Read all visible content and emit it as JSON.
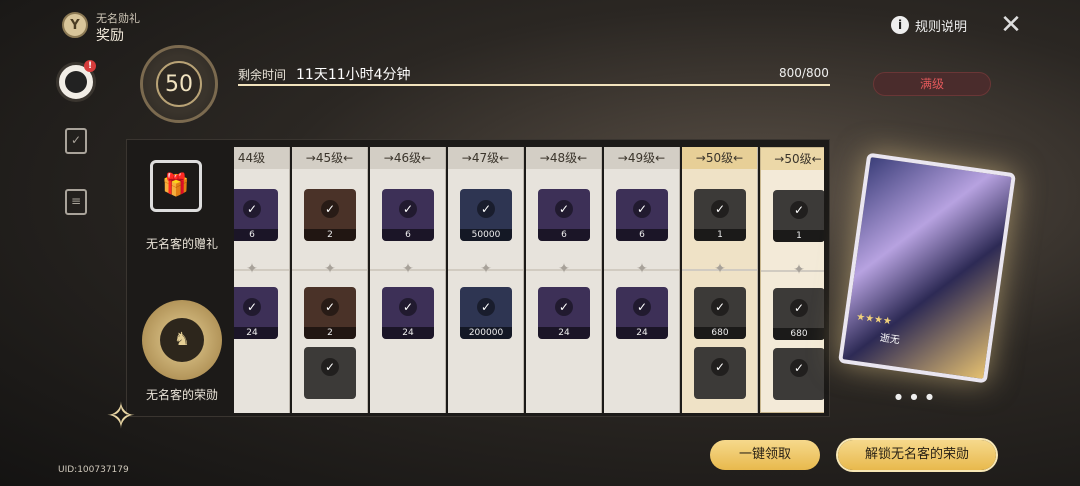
{
  "header": {
    "subtitle": "无名勋礼",
    "title": "奖励",
    "rules_label": "规则说明",
    "emblem_glyph": "Y"
  },
  "nav": {
    "badge": "!",
    "items": [
      {
        "name": "nav-battle-pass",
        "icon": "emblem-icon"
      },
      {
        "name": "nav-tasks",
        "icon": "clipboard-icon"
      },
      {
        "name": "nav-log",
        "icon": "document-icon"
      }
    ]
  },
  "level": {
    "current": "50",
    "time_label": "剩余时间",
    "time_value": "11天11小时4分钟",
    "exp": "800/800",
    "progress": 1.0,
    "max_label": "满级"
  },
  "rows": {
    "free_label": "无名客的赠礼",
    "honor_label": "无名客的荣勋"
  },
  "columns": [
    {
      "label": "44级",
      "style": "normal",
      "free": {
        "qty": "6",
        "color": "purple"
      },
      "honor": [
        {
          "qty": "24",
          "color": "purple"
        }
      ]
    },
    {
      "label": "→45级←",
      "style": "normal",
      "free": {
        "qty": "2",
        "color": "orange"
      },
      "honor": [
        {
          "qty": "2",
          "color": "orange"
        },
        {
          "qty": "",
          "color": "gray"
        }
      ]
    },
    {
      "label": "→46级←",
      "style": "normal",
      "free": {
        "qty": "6",
        "color": "purple"
      },
      "honor": [
        {
          "qty": "24",
          "color": "purple"
        }
      ]
    },
    {
      "label": "→47级←",
      "style": "normal",
      "free": {
        "qty": "50000",
        "color": "blue"
      },
      "honor": [
        {
          "qty": "200000",
          "color": "blue"
        }
      ]
    },
    {
      "label": "→48级←",
      "style": "normal",
      "free": {
        "qty": "6",
        "color": "purple"
      },
      "honor": [
        {
          "qty": "24",
          "color": "purple"
        }
      ]
    },
    {
      "label": "→49级←",
      "style": "normal",
      "free": {
        "qty": "6",
        "color": "purple"
      },
      "honor": [
        {
          "qty": "24",
          "color": "purple"
        }
      ]
    },
    {
      "label": "→50级←",
      "style": "gold",
      "free": {
        "qty": "1",
        "color": "gray"
      },
      "honor": [
        {
          "qty": "680",
          "color": "gray"
        },
        {
          "qty": "",
          "color": "gray"
        }
      ]
    },
    {
      "label": "→50级←",
      "style": "cur",
      "free": {
        "qty": "1",
        "color": "gray"
      },
      "honor": [
        {
          "qty": "680",
          "color": "gray"
        },
        {
          "qty": "",
          "color": "gray"
        }
      ]
    }
  ],
  "card": {
    "name": "逝无",
    "stars": "★★★★"
  },
  "buttons": {
    "claim_all": "一键领取",
    "unlock": "解锁无名客的荣勋"
  },
  "uid": "UID:100737179",
  "colors": {
    "accent_gold": "#e8b94d",
    "max_red": "#e0585a"
  }
}
